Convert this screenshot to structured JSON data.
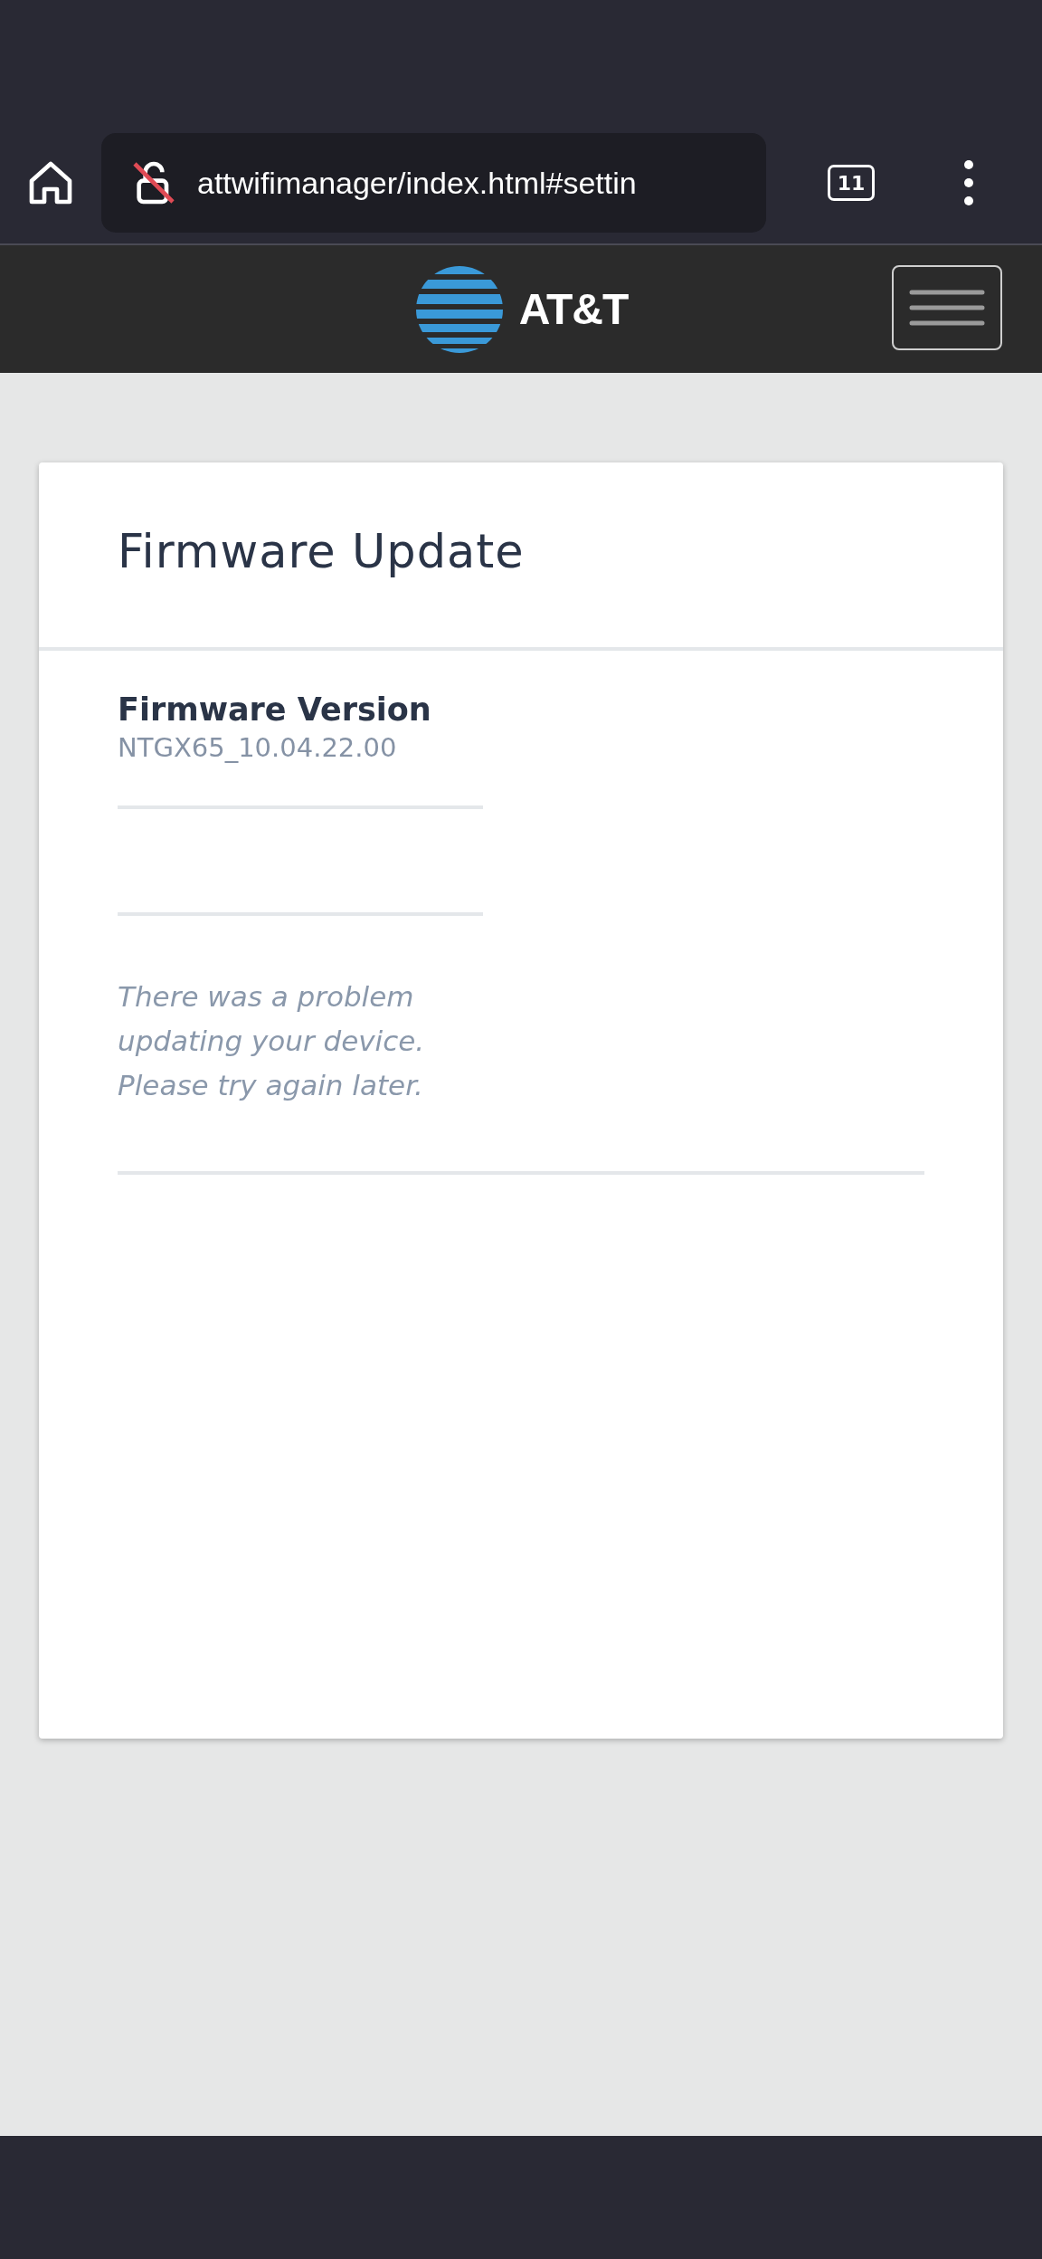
{
  "browser": {
    "url": "attwifimanager/index.html#settin",
    "tab_count": "11",
    "secure": false
  },
  "header": {
    "brand": "AT&T"
  },
  "card": {
    "title": "Firmware Update",
    "section_title": "Firmware Version",
    "version": "NTGX65_10.04.22.00",
    "message": "There was a problem updating your device. Please try again later."
  }
}
